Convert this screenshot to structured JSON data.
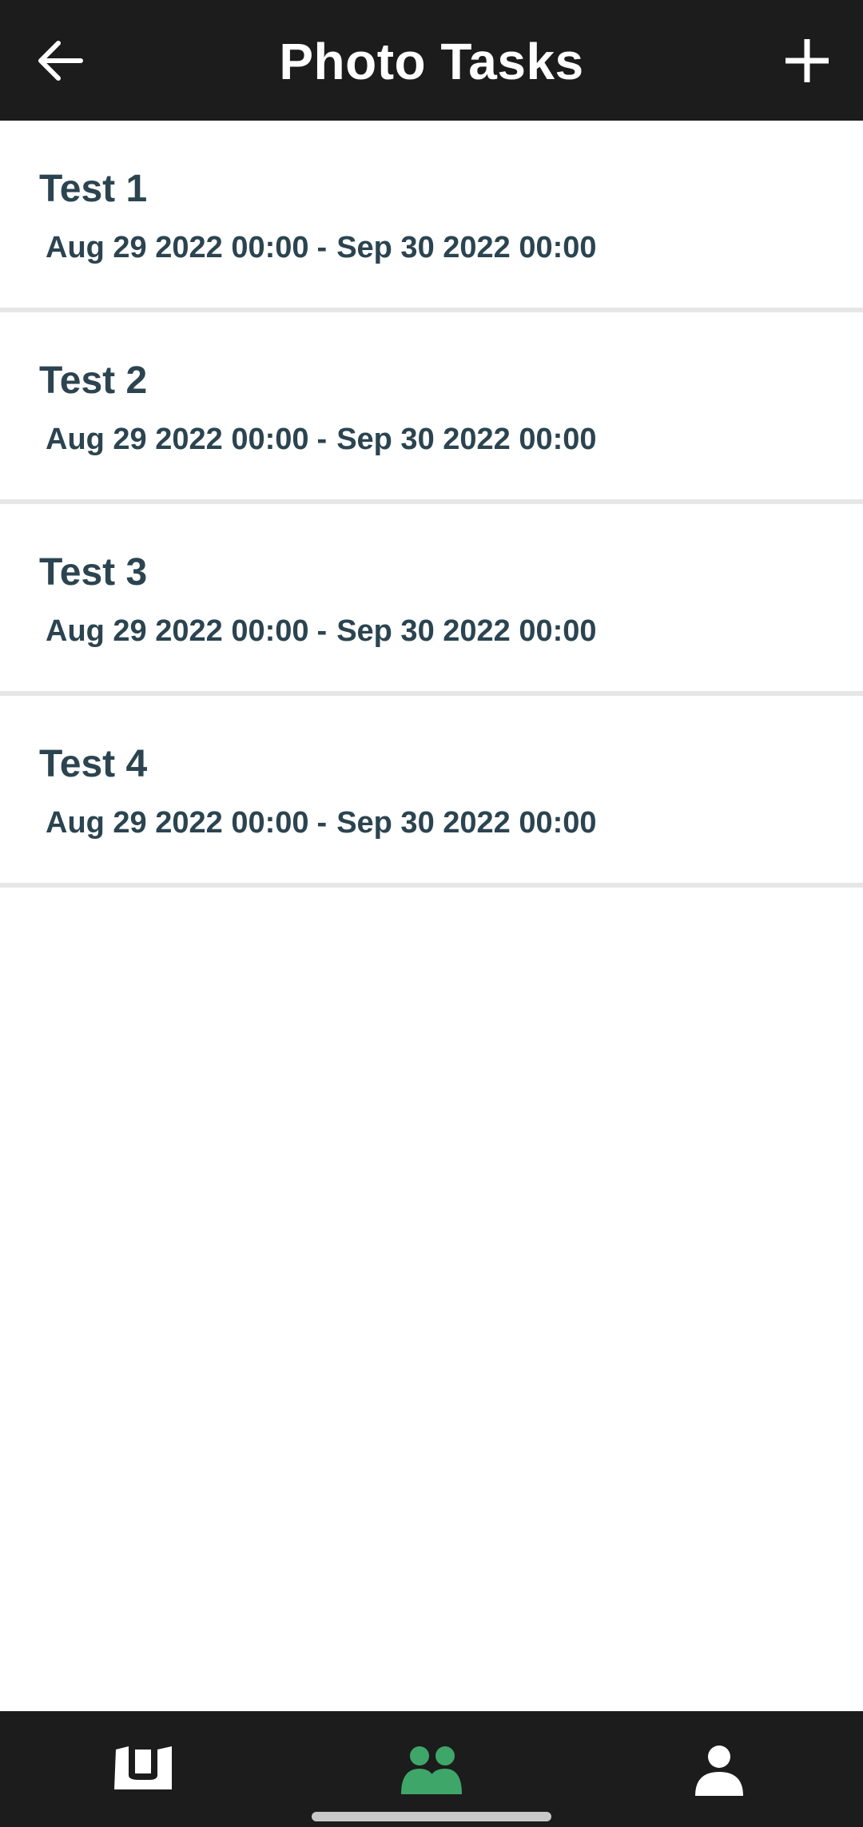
{
  "header": {
    "title": "Photo Tasks",
    "back_icon": "arrow-left-icon",
    "add_icon": "plus-icon"
  },
  "tasks": [
    {
      "title": "Test 1",
      "start": "Aug 29 2022 00:00",
      "separator": "-",
      "end": "Sep 30 2022 00:00"
    },
    {
      "title": "Test 2",
      "start": "Aug 29 2022 00:00",
      "separator": "-",
      "end": "Sep 30 2022 00:00"
    },
    {
      "title": "Test 3",
      "start": "Aug 29 2022 00:00",
      "separator": "-",
      "end": "Sep 30 2022 00:00"
    },
    {
      "title": "Test 4",
      "start": "Aug 29 2022 00:00",
      "separator": "-",
      "end": "Sep 30 2022 00:00"
    }
  ],
  "bottom_nav": {
    "items": [
      {
        "icon": "brand-logo-icon",
        "active": false
      },
      {
        "icon": "group-icon",
        "active": true
      },
      {
        "icon": "profile-icon",
        "active": false
      }
    ]
  },
  "colors": {
    "bar_background": "#1c1c1c",
    "text_primary": "#2b4450",
    "active_accent": "#3fa66a",
    "divider": "#e6e6e6"
  }
}
